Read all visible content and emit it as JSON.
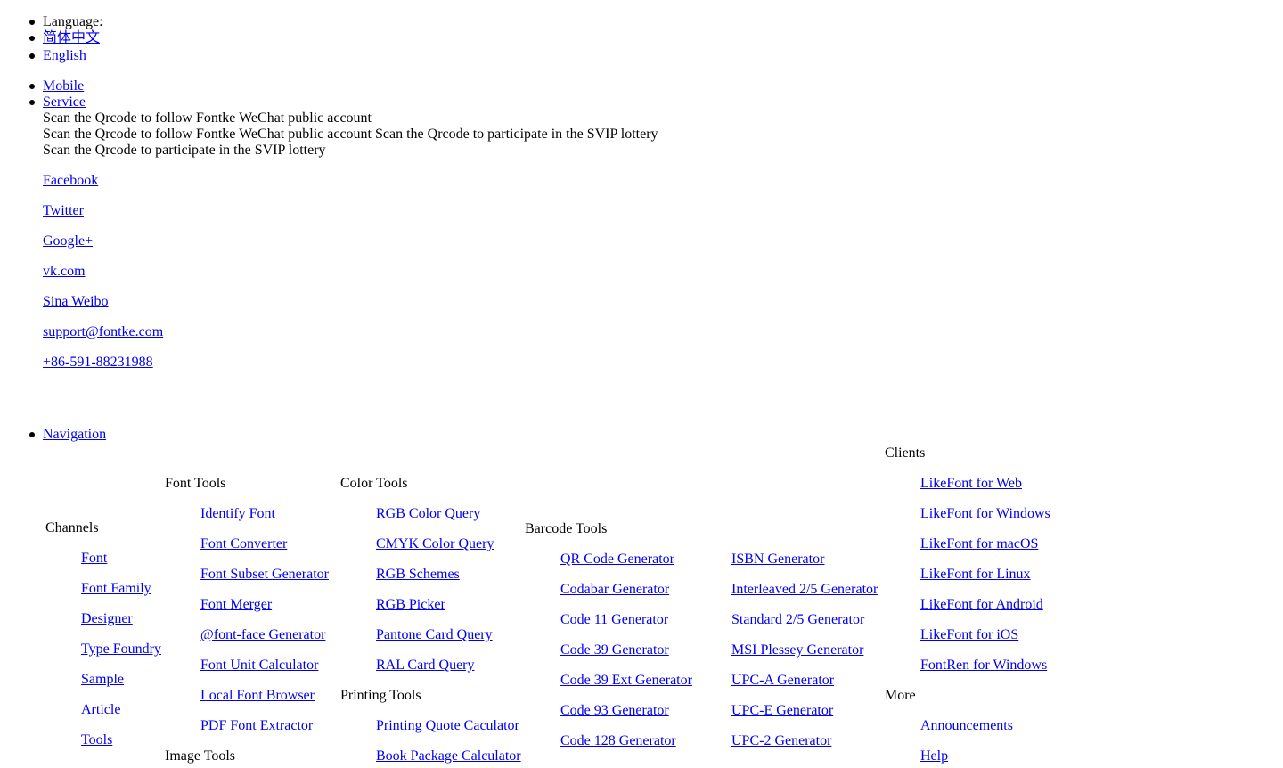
{
  "top": {
    "language_label": "Language:",
    "languages": [
      "简体中文",
      "English"
    ],
    "mobile": "Mobile",
    "service": "Service",
    "qr_wechat_alt": "Scan the Qrcode to follow Fontke WeChat public account",
    "qr_wechat_caption": "Scan the Qrcode to follow Fontke WeChat public account",
    "qr_svip_alt": "Scan the Qrcode to participate in the SVIP lottery",
    "qr_svip_caption": "Scan the Qrcode to participate in the SVIP lottery",
    "social": [
      "Facebook",
      "Twitter",
      "Google+",
      "vk.com",
      "Sina Weibo"
    ],
    "email": "support@fontke.com",
    "phone": "+86-591-88231988"
  },
  "nav": {
    "label": "Navigation",
    "channels": {
      "title": "Channels",
      "items": [
        "Font",
        "Font Family",
        "Designer",
        "Type Foundry",
        "Sample",
        "Article",
        "Tools"
      ]
    },
    "font_tools": {
      "title": "Font Tools",
      "items": [
        "Identify Font",
        "Font Converter",
        "Font Subset Generator",
        "Font Merger",
        "@font-face Generator",
        "Font Unit Calculator",
        "Local Font Browser",
        "PDF Font Extractor"
      ]
    },
    "image_tools": {
      "title": "Image Tools"
    },
    "color_tools": {
      "title": "Color Tools",
      "items": [
        "RGB Color Query",
        "CMYK Color Query",
        "RGB Schemes",
        "RGB Picker",
        "Pantone Card Query",
        "RAL Card Query"
      ]
    },
    "printing_tools": {
      "title": "Printing Tools",
      "items": [
        "Printing Quote Caculator",
        "Book Package Calculator"
      ]
    },
    "barcode_tools": {
      "title": "Barcode Tools",
      "col1": [
        "QR Code Generator",
        "Codabar Generator",
        "Code 11 Generator",
        "Code 39 Generator",
        "Code 39 Ext Generator",
        "Code 93 Generator",
        "Code 128 Generator"
      ],
      "col2": [
        "ISBN Generator",
        "Interleaved 2/5 Generator",
        "Standard 2/5 Generator",
        "MSI Plessey Generator",
        "UPC-A Generator",
        "UPC-E Generator",
        "UPC-2 Generator"
      ]
    },
    "clients": {
      "title": "Clients",
      "items": [
        "LikeFont for Web",
        "LikeFont for Windows",
        "LikeFont for macOS",
        "LikeFont for Linux",
        "LikeFont for Android",
        "LikeFont for iOS",
        "FontRen for Windows"
      ]
    },
    "more": {
      "title": "More",
      "items": [
        "Announcements",
        "Help"
      ]
    }
  }
}
